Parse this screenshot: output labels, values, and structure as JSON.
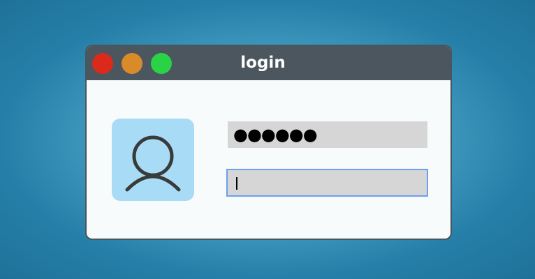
{
  "window": {
    "title": "login",
    "controls": {
      "close_color": "#db2a1c",
      "minimize_color": "#d98b2a",
      "maximize_color": "#2ad345"
    }
  },
  "avatar": {
    "icon": "user-icon",
    "background_color": "#a8dcf6"
  },
  "password_field": {
    "masked_value": "●●●●●●"
  },
  "username_field": {
    "value": "",
    "placeholder": "",
    "focused": true
  },
  "colors": {
    "focus_ring": "#6da0f0",
    "field_background": "#d6d6d6",
    "titlebar": "#4b565e"
  }
}
